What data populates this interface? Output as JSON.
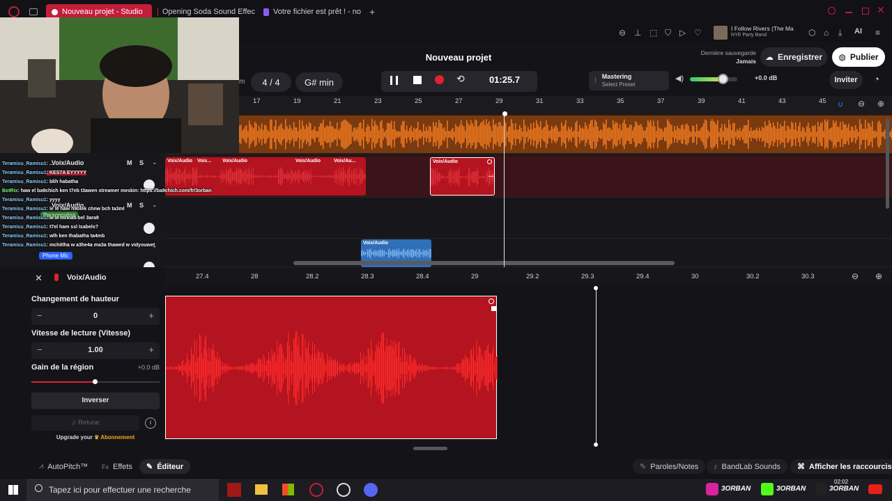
{
  "browser": {
    "tabs": [
      {
        "label": "Nouveau projet - Studio",
        "active": true,
        "icon": "bandlab-icon"
      },
      {
        "label": "Opening Soda Sound Effec",
        "active": false,
        "icon": "youtube-icon"
      },
      {
        "label": "Votre fichier est prêt ! - no",
        "active": false,
        "icon": "file-icon"
      }
    ],
    "new_tab": "+",
    "media": {
      "title": "I Follow Rivers (The Ma",
      "subtitle": "NYE Party Band"
    },
    "ai_label": "AI"
  },
  "header": {
    "project_title": "Nouveau projet",
    "save_status_label": "Dernière sauvegarde",
    "save_status_value": "Jamais",
    "save_button": "Enregistrer",
    "publish_button": "Publier"
  },
  "transport": {
    "tempo_suffix": "m",
    "time_signature": "4 / 4",
    "key": "G# min",
    "time": "01:25.7",
    "mastering_title": "Mastering",
    "mastering_preset": "Select Preset",
    "volume_db": "+0.0 dB",
    "volume_level": 0.7,
    "invite_button": "Inviter"
  },
  "ruler": [
    "17",
    "19",
    "21",
    "23",
    "25",
    "27",
    "29",
    "31",
    "33",
    "35",
    "37",
    "39",
    "41",
    "43",
    "45"
  ],
  "tracks": [
    {
      "name": "Voix/Audio",
      "mute": "M",
      "solo": "S",
      "effect": "Personnalisé"
    },
    {
      "name": "Voix/Audio",
      "mute": "M",
      "solo": "S",
      "effect": ""
    },
    {
      "name": "Voix/Audio",
      "mute": "M",
      "solo": "S",
      "effect": "Phone Mic"
    }
  ],
  "clips": {
    "row1": [
      "Voix/Audio",
      "Voix...",
      "Voix/Audio",
      "Voix/Audio",
      "Voix/Au...",
      "Voix/Audio"
    ],
    "row2": [
      "Voix/Audio"
    ]
  },
  "chat": [
    {
      "user": "Teramisu_Ramisu1",
      "msg": ": ...."
    },
    {
      "user": "Teramisu_Ramisu1",
      "msg": ": KES7A EYYYYY"
    },
    {
      "user": "Teramisu_Ramisu1",
      "msg": ": blih habatha"
    },
    {
      "user": "BotRix",
      "msg": ": haw el ba9chich ken t7eb t3awen streamer meskin: https://ba9chich.com/fr/3orban"
    },
    {
      "user": "Teramisu_Ramisu1",
      "msg": ": yyyy"
    },
    {
      "user": "Teramisu_Ramisu1",
      "msg": ": le le haw n9olek chnw bch ta3ml"
    },
    {
      "user": "Teramisu_Ramisu1",
      "msg": ": le le mrina5 bel 3ara9"
    },
    {
      "user": "Teramisu_Ramisu1",
      "msg": ": t7el ham ssl Isabels?"
    },
    {
      "user": "Teramisu_Ramisu1",
      "msg": ": wlh ken thabatha ta4mb"
    },
    {
      "user": "Teramisu_Ramisu1",
      "msg": ": mchitlha w a3he4a ma3a thawed w vidyouwet"
    }
  ],
  "editor": {
    "track_title": "Voix/Audio",
    "pitch_label": "Changement de hauteur",
    "pitch_value": "0",
    "speed_label": "Vitesse de lecture (Vitesse)",
    "speed_value": "1.00",
    "gain_label": "Gain de la région",
    "gain_value": "+0.0 dB",
    "gain_level": 0.6,
    "reverse_button": "Inverser",
    "retune_button": "Retune",
    "upgrade_text": "Upgrade your",
    "upgrade_link": "Abonnement",
    "ruler": [
      "27.4",
      "28",
      "28.2",
      "28.3",
      "28.4",
      "29",
      "29.2",
      "29.3",
      "29.4",
      "30",
      "30.2",
      "30.3"
    ]
  },
  "bottom_tabs": {
    "autopitch": "AutoPitch™",
    "effects": "Effets",
    "editor": "Éditeur",
    "lyrics": "Paroles/Notes",
    "sounds": "BandLab Sounds",
    "shortcuts": "Afficher les raccourcis"
  },
  "taskbar": {
    "search_placeholder": "Tapez ici pour effectuer une recherche",
    "clock": "02:02",
    "social_handle": "3ORBAN"
  },
  "colors": {
    "accent": "#c41d3a",
    "orange": "#f07a1f",
    "red_clip": "#b3141f",
    "blue_clip": "#2f6fb8"
  }
}
